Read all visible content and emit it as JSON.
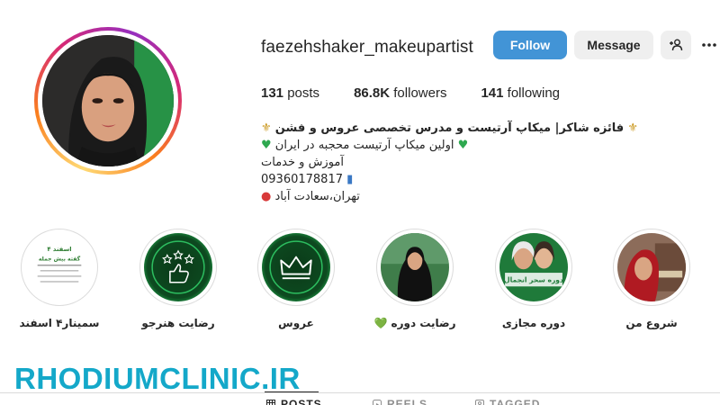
{
  "profile": {
    "username": "faezehshaker_makeupartist",
    "follow_label": "Follow",
    "message_label": "Message",
    "stats": {
      "posts_count": "131",
      "posts_label": "posts",
      "followers_count": "86.8K",
      "followers_label": "followers",
      "following_count": "141",
      "following_label": "following"
    },
    "bio": {
      "line1": "فائزه شاکر| میکاپ آرتیست و مدرس تخصصی عروس و فشن",
      "line2": "اولین میکاپ آرتیست محجبه در ایران",
      "line3": "آموزش و خدمات",
      "line4": "09360178817",
      "line5": "تهران،سعادت آباد"
    }
  },
  "highlights": [
    {
      "label": "شروع من",
      "icon": "portrait-photo"
    },
    {
      "label": "دوره مجازی",
      "icon": "course-poster"
    },
    {
      "label": "رضایت دوره 💚",
      "icon": "portrait-photo"
    },
    {
      "label": "عروس",
      "icon": "crown-icon"
    },
    {
      "label": "رضایت هنرجو",
      "icon": "thumbs-up-stars-icon"
    },
    {
      "label": "سمینار۴ اسفند",
      "icon": "seminar-poster"
    }
  ],
  "highlight_posters": {
    "course_title": "دوره سحر انجمال",
    "seminar_title": "۴ اسفند",
    "seminar_subtitle": "گفته بیش جمله"
  },
  "tabs": [
    {
      "label": "POSTS",
      "icon": "grid-icon",
      "active": true
    },
    {
      "label": "REELS",
      "icon": "reels-icon",
      "active": false
    },
    {
      "label": "TAGGED",
      "icon": "tag-icon",
      "active": false
    }
  ],
  "watermark": "RHODIUMCLINIC.IR",
  "colors": {
    "follow_button": "#4294d6",
    "secondary_button": "#efefef",
    "heart": "#2ea84f",
    "watermark": "#14a8c9"
  }
}
